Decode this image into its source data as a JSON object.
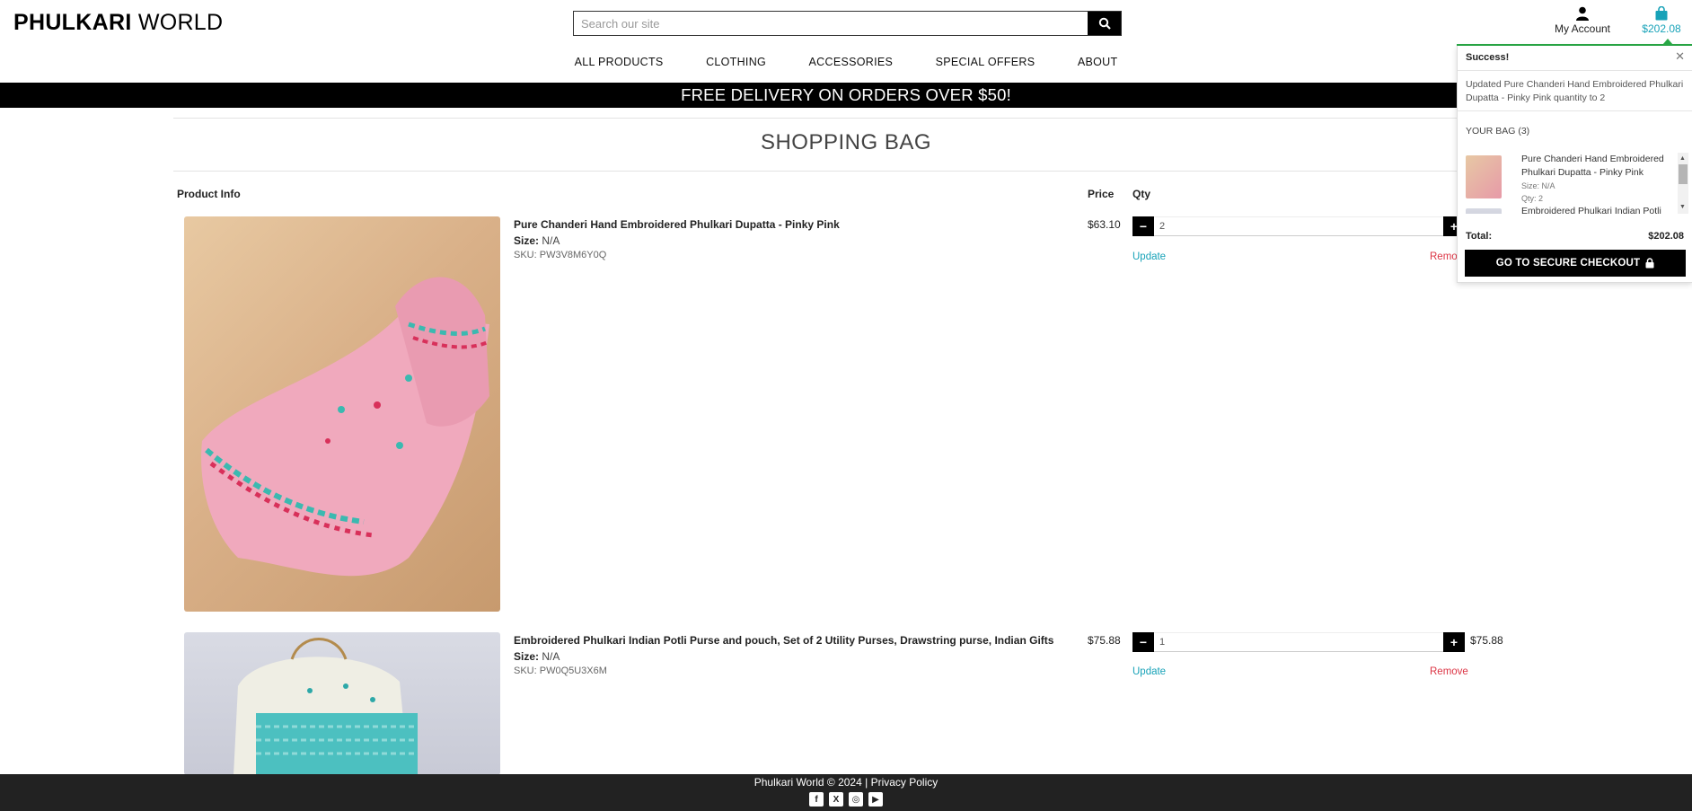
{
  "header": {
    "logo_bold": "PHULKARI",
    "logo_rest": "WORLD",
    "search_placeholder": "Search our site",
    "account_label": "My Account",
    "bag_total": "$202.08"
  },
  "nav": {
    "items": [
      "ALL PRODUCTS",
      "CLOTHING",
      "ACCESSORIES",
      "SPECIAL OFFERS",
      "ABOUT"
    ]
  },
  "banner": "FREE DELIVERY ON ORDERS OVER $50!",
  "page": {
    "title": "SHOPPING BAG",
    "headers": {
      "product_info": "Product Info",
      "price": "Price",
      "qty": "Qty"
    }
  },
  "items": [
    {
      "name": "Pure Chanderi Hand Embroidered Phulkari Dupatta - Pinky Pink",
      "size_label": "Size:",
      "size": "N/A",
      "sku": "SKU: PW3V8M6Y0Q",
      "price": "$63.10",
      "qty": "2",
      "update": "Update",
      "remove": "Remove"
    },
    {
      "name": "Embroidered Phulkari Indian Potli Purse and pouch, Set of 2 Utility Purses, Drawstring purse, Indian Gifts",
      "size_label": "Size:",
      "size": "N/A",
      "sku": "SKU: PW0Q5U3X6M",
      "price": "$75.88",
      "qty": "1",
      "subtotal": "$75.88",
      "update": "Update",
      "remove": "Remove"
    }
  ],
  "toast": {
    "title": "Success!",
    "message": "Updated Pure Chanderi Hand Embroidered Phulkari Dupatta - Pinky Pink quantity to 2",
    "bag_heading": "YOUR BAG (3)",
    "bag_items": [
      {
        "name": "Pure Chanderi Hand Embroidered Phulkari Dupatta - Pinky Pink",
        "size": "Size: N/A",
        "qty": "Qty: 2"
      },
      {
        "name": "Embroidered Phulkari Indian Potli"
      }
    ],
    "total_label": "Total:",
    "total_value": "$202.08",
    "checkout_label": "GO TO SECURE CHECKOUT"
  },
  "footer": {
    "copyright": "Phulkari World © 2024 |",
    "privacy": "Privacy Policy",
    "social_icons": [
      "facebook-icon",
      "x-twitter-icon",
      "instagram-icon",
      "youtube-icon"
    ]
  },
  "colors": {
    "accent": "#17a2b8",
    "success": "#28a745",
    "remove": "#dc3545",
    "banner_bg": "#000000",
    "footer_bg": "#222222"
  }
}
